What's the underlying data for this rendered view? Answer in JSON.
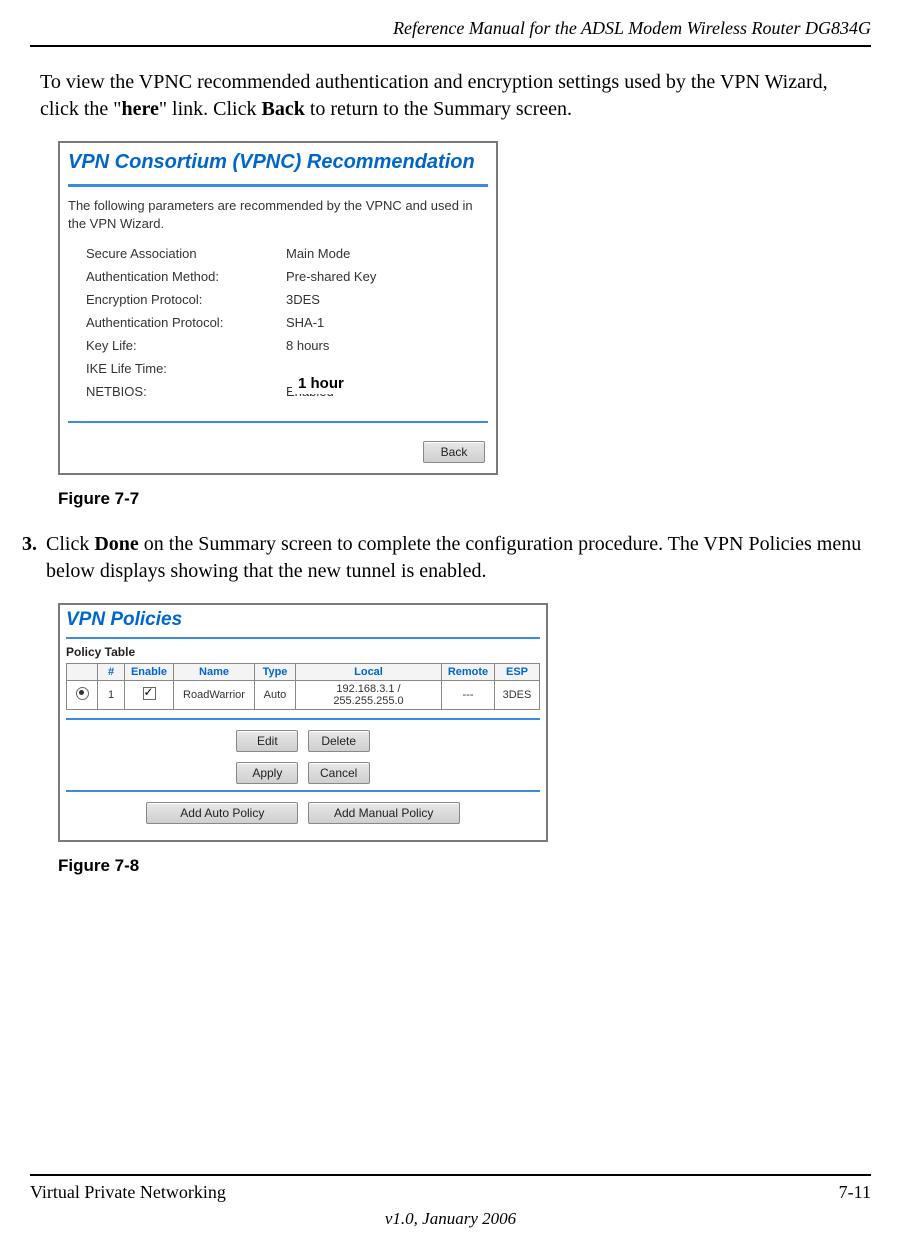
{
  "header": {
    "title": "Reference Manual for the ADSL Modem Wireless Router DG834G"
  },
  "para1": {
    "pre": "To view the VPNC recommended authentication and encryption settings used by the VPN Wizard, click the \"",
    "bold1": "here",
    "mid": "\" link. Click ",
    "bold2": "Back",
    "post": " to return to the Summary screen."
  },
  "fig7_7": {
    "caption": "Figure 7-7",
    "panel_title": "VPN Consortium (VPNC) Recommendation",
    "desc1": "The following parameters are recommended by the VPNC and used in the VPN Wizard.",
    "rows": [
      {
        "label": "Secure Association",
        "value": "Main Mode"
      },
      {
        "label": "Authentication Method:",
        "value": "Pre-shared Key"
      },
      {
        "label": "Encryption Protocol:",
        "value": "3DES"
      },
      {
        "label": "Authentication Protocol:",
        "value": "SHA-1"
      },
      {
        "label": "Key Life:",
        "value": "8 hours"
      },
      {
        "label": "IKE Life Time:",
        "value": ""
      },
      {
        "label": "NETBIOS:",
        "value": "Enabled"
      }
    ],
    "overlay_text": "1 hour",
    "back_btn": "Back"
  },
  "step3": {
    "num": "3.",
    "pre": "Click ",
    "bold1": "Done",
    "post": " on the Summary screen to complete the configuration procedure. The VPN Policies menu below displays showing that the new tunnel is enabled."
  },
  "fig7_8": {
    "caption": "Figure 7-8",
    "panel_title": "VPN Policies",
    "section_title": "Policy Table",
    "headers": [
      "",
      "#",
      "Enable",
      "Name",
      "Type",
      "Local",
      "Remote",
      "ESP"
    ],
    "row": {
      "num": "1",
      "name": "RoadWarrior",
      "type": "Auto",
      "local": "192.168.3.1 / 255.255.255.0",
      "remote": "---",
      "esp": "3DES"
    },
    "buttons": {
      "edit": "Edit",
      "delete": "Delete",
      "apply": "Apply",
      "cancel": "Cancel",
      "add_auto": "Add Auto Policy",
      "add_manual": "Add Manual Policy"
    }
  },
  "footer": {
    "left": "Virtual Private Networking",
    "right": "7-11",
    "version": "v1.0, January 2006"
  }
}
